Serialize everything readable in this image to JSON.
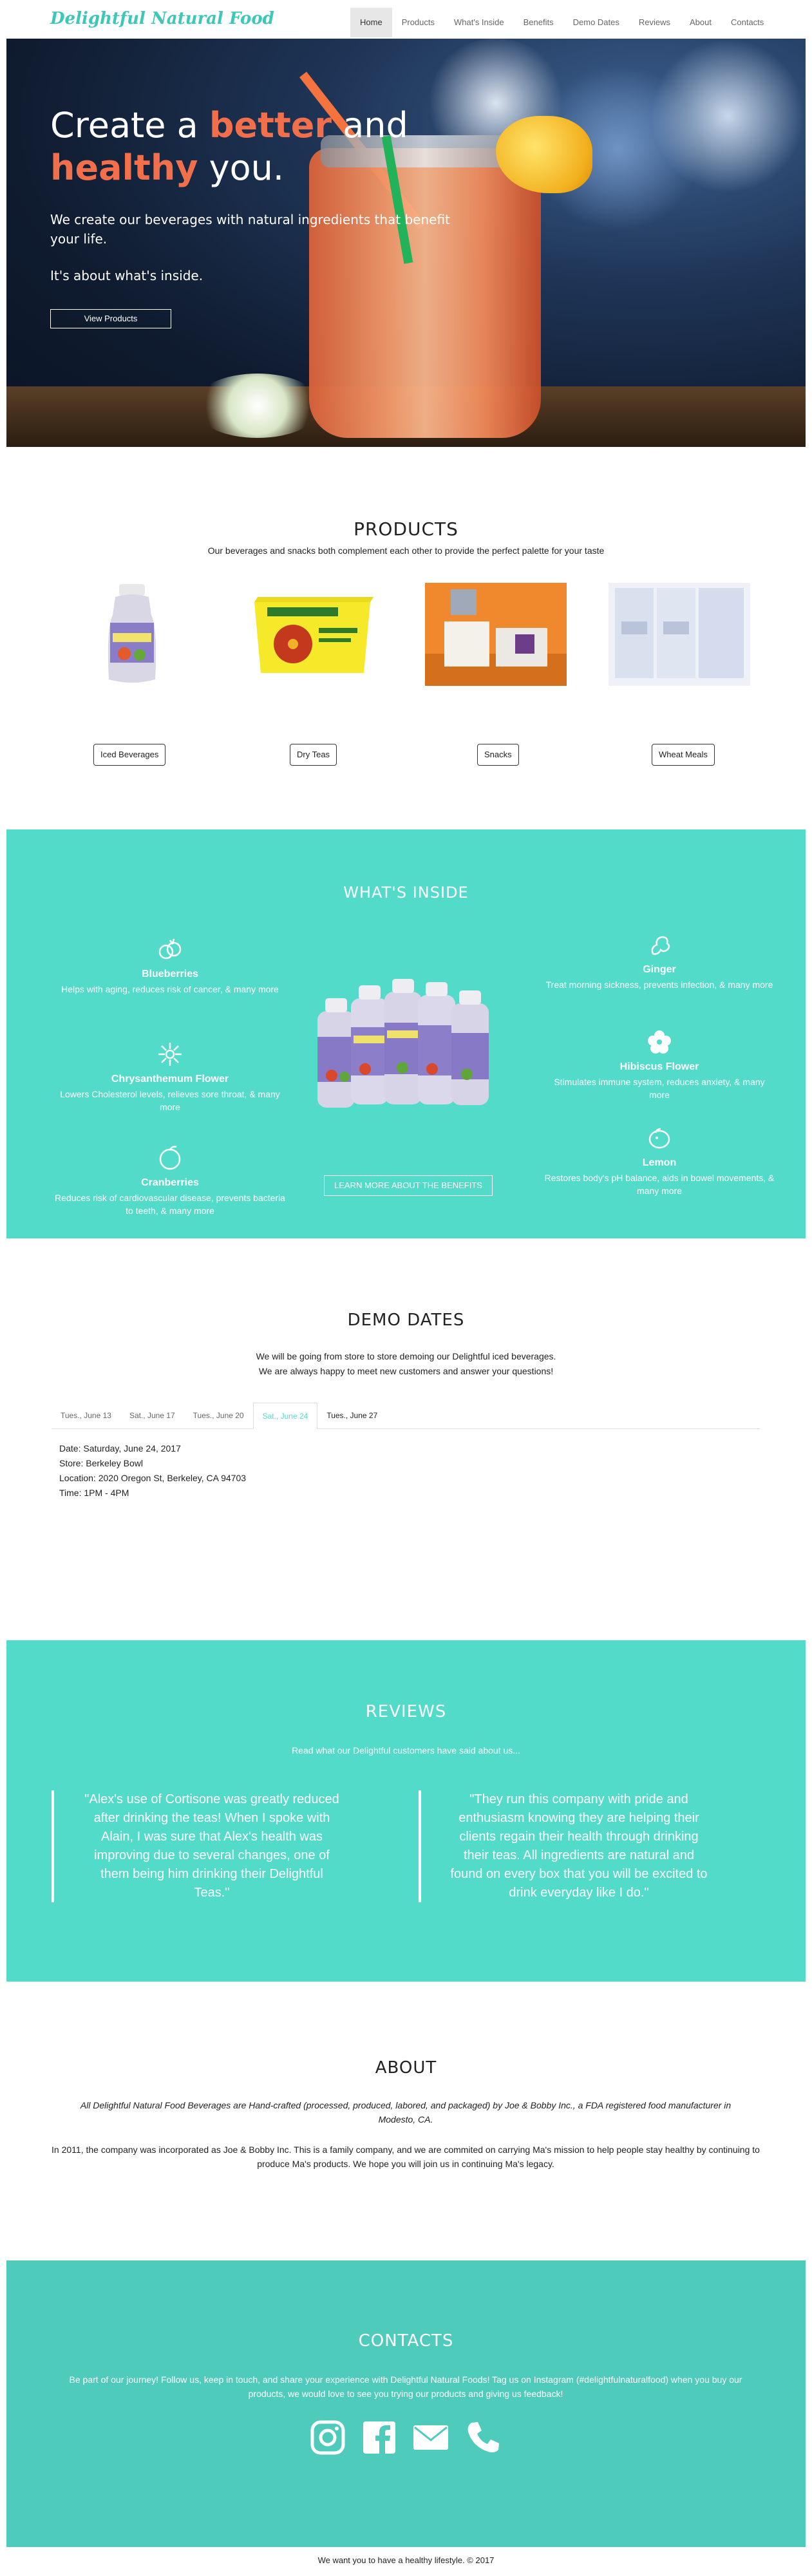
{
  "brand": {
    "name": "Delightful Natural Food"
  },
  "nav": {
    "items": [
      {
        "label": "Home"
      },
      {
        "label": "Products"
      },
      {
        "label": "What's Inside"
      },
      {
        "label": "Benefits"
      },
      {
        "label": "Demo Dates"
      },
      {
        "label": "Reviews"
      },
      {
        "label": "About"
      },
      {
        "label": "Contacts"
      }
    ],
    "active": "Home"
  },
  "hero": {
    "line1_a": "Create a ",
    "line1_accent": "better",
    "line1_b": " and",
    "line2_accent": "healthy",
    "line2_b": " you.",
    "subtitle": "We create our beverages with natural ingredients that benefit your life.",
    "tagline": "It's about what's inside.",
    "button": "View Products"
  },
  "products": {
    "title": "PRODUCTS",
    "subtitle": "Our beverages and snacks both complement each other to provide the perfect palette for your taste",
    "items": [
      {
        "label": "Iced Beverages"
      },
      {
        "label": "Dry Teas"
      },
      {
        "label": "Snacks"
      },
      {
        "label": "Wheat Meals"
      }
    ]
  },
  "whats_inside": {
    "title": "WHAT'S INSIDE",
    "items": [
      {
        "name": "Blueberries",
        "desc": "Helps with aging, reduces risk of cancer, & many more",
        "icon": "blueberries-icon"
      },
      {
        "name": "Chrysanthemum Flower",
        "desc": "Lowers Cholesterol levels, relieves sore throat, & many more",
        "icon": "chrysanthemum-icon"
      },
      {
        "name": "Cranberries",
        "desc": "Reduces risk of cardiovascular disease, prevents bacteria to teeth, & many more",
        "icon": "cranberries-icon"
      },
      {
        "name": "Ginger",
        "desc": "Treat morning sickness, prevents infection, & many more",
        "icon": "ginger-icon"
      },
      {
        "name": "Hibiscus Flower",
        "desc": "Stimulates immune system, reduces anxiety, & many more",
        "icon": "hibiscus-icon"
      },
      {
        "name": "Lemon",
        "desc": "Restores body's pH balance, aids in bowel movements, & many more",
        "icon": "lemon-icon"
      }
    ],
    "button": "LEARN MORE ABOUT THE BENEFITS"
  },
  "demo": {
    "title": "DEMO DATES",
    "line1": "We will be going from store to store demoing our Delightful iced beverages.",
    "line2": "We are always happy to meet new customers and answer your questions!",
    "tabs": [
      {
        "label": "Tues., June 13"
      },
      {
        "label": "Sat., June 17"
      },
      {
        "label": "Tues., June 20"
      },
      {
        "label": "Sat., June 24"
      },
      {
        "label": "Tues., June 27"
      }
    ],
    "active_tab": "Sat., June 24",
    "details": {
      "date": "Date: Saturday, June 24, 2017",
      "store": "Store: Berkeley Bowl",
      "location": "Location: 2020 Oregon St, Berkeley, CA 94703",
      "time": "Time: 1PM - 4PM"
    }
  },
  "reviews": {
    "title": "REVIEWS",
    "subtitle": "Read what our Delightful customers have said about us...",
    "quotes": [
      "\"Alex's use of Cortisone was greatly reduced after drinking the teas! When I spoke with Alain, I was sure that Alex's health was improving due to several changes, one of them being him drinking their Delightful Teas.\"",
      "\"They run this company with pride and enthusiasm knowing they are helping their clients regain their health through drinking their teas. All ingredients are natural and found on every box that you will be excited to drink everyday like I do.\""
    ]
  },
  "about": {
    "title": "ABOUT",
    "italic": "All Delightful Natural Food Beverages are Hand-crafted (processed, produced, labored, and packaged) by Joe & Bobby Inc., a FDA registered food manufacturer in Modesto, CA.",
    "body": "In 2011, the company was incorporated as Joe & Bobby Inc. This is a family company, and we are commited on carrying Ma's mission to help people stay healthy by continuing to produce Ma's products. We hope you will join us in continuing Ma's legacy."
  },
  "contacts": {
    "title": "CONTACTS",
    "body": "Be part of our journey! Follow us, keep in touch, and share your experience with Delightful Natural Foods! Tag us on Instagram (#delightfulnaturalfood) when you buy our products, we would love to see you trying our products and giving us feedback!",
    "icons": [
      "instagram-icon",
      "facebook-icon",
      "email-icon",
      "phone-icon"
    ]
  },
  "footer": {
    "text": "We want you to have a healthy lifestyle. © 2017"
  },
  "colors": {
    "teal": "#52dbc9",
    "teal_dark": "#4fcbbb",
    "accent": "#f26f4c",
    "brand": "#3ec7b7"
  }
}
